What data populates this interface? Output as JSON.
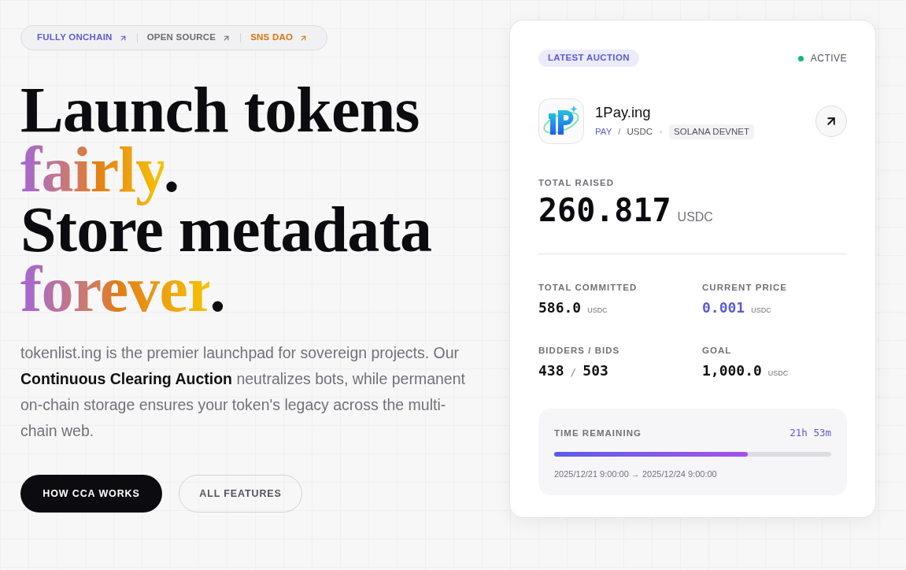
{
  "hero": {
    "links": [
      {
        "label": "FULLY ONCHAIN",
        "color": "#5b5bd6"
      },
      {
        "label": "OPEN SOURCE",
        "color": "#6b6b76"
      },
      {
        "label": "SNS DAO",
        "color": "#d9740c"
      }
    ],
    "headline": [
      {
        "parts": [
          {
            "text": "Launch tokens",
            "gradient": false
          }
        ]
      },
      {
        "parts": [
          {
            "text": "fairly",
            "gradient": true
          },
          {
            "text": ".",
            "gradient": false
          }
        ]
      },
      {
        "parts": [
          {
            "text": "Store metadata",
            "gradient": false
          }
        ]
      },
      {
        "parts": [
          {
            "text": "forever",
            "gradient": true
          },
          {
            "text": ".",
            "gradient": false
          }
        ]
      }
    ],
    "description": "tokenlist.ing is the premier launchpad for sovereign projects. Our **Continuous Clearing Auction** neutralizes bots, while permanent on-chain storage ensures your token's legacy across the multi-chain web.",
    "buttons": [
      {
        "label": "HOW CCA WORKS",
        "kind": "primary"
      },
      {
        "label": "ALL FEATURES",
        "kind": "secondary"
      }
    ]
  },
  "auction_card": {
    "badge": "LATEST AUCTION",
    "status": {
      "label": "ACTIVE",
      "live": true
    },
    "token": {
      "name": "1Pay.ing",
      "symbol": "PAY",
      "separator": "/",
      "quote": "USDC",
      "network": "SOLANA DEVNET"
    },
    "raised": {
      "label": "TOTAL RAISED",
      "value": "260.817",
      "unit": "USDC"
    },
    "stats": [
      {
        "kind": "amount",
        "label": "TOTAL COMMITTED",
        "value": "586.0",
        "unit": "USDC",
        "highlight": false
      },
      {
        "kind": "amount",
        "label": "CURRENT PRICE",
        "value": "0.001",
        "unit": "USDC",
        "highlight": true
      },
      {
        "kind": "ratio",
        "label": "BIDDERS / BIDS",
        "values": [
          "438",
          "503"
        ],
        "separator": "/"
      },
      {
        "kind": "amount",
        "label": "GOAL",
        "value": "1,000.0",
        "unit": "USDC",
        "highlight": false
      }
    ],
    "timer": {
      "label": "TIME REMAINING",
      "value": "21h 53m",
      "level": 0.7,
      "range": "2025/12/21 9:00:00 → 2025/12/24 9:00:00"
    }
  }
}
